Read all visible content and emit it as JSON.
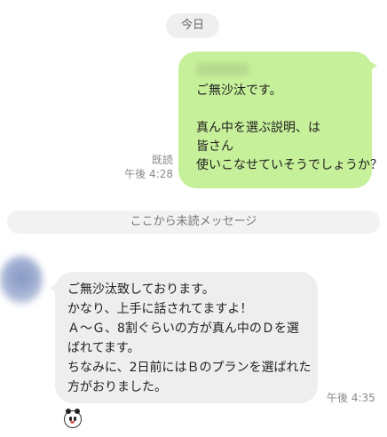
{
  "date_label": "今日",
  "outgoing": {
    "sender_name_blurred": "",
    "lines": [
      "ご無沙汰です。",
      "",
      "真ん中を選ぶ説明、は",
      "皆さん",
      "使いこなせていそうでしょうか？"
    ],
    "read_label": "既読",
    "time": "午後 4:28",
    "bubble_color": "#c7f09a"
  },
  "unread_divider": "ここから未読メッセージ",
  "incoming": {
    "lines": [
      "ご無沙汰致しております。",
      "かなり、上手に話されてますよ！",
      "Ａ～Ｇ、8割ぐらいの方が真ん中のＤを選",
      "ばれてます。",
      "ちなみに、2日前にはＢのプランを選ばれた",
      "方がおりました。"
    ],
    "time": "午後 4:35",
    "bubble_color": "#eeeeee",
    "reaction_icon": "mouse-face-sticker-icon"
  }
}
